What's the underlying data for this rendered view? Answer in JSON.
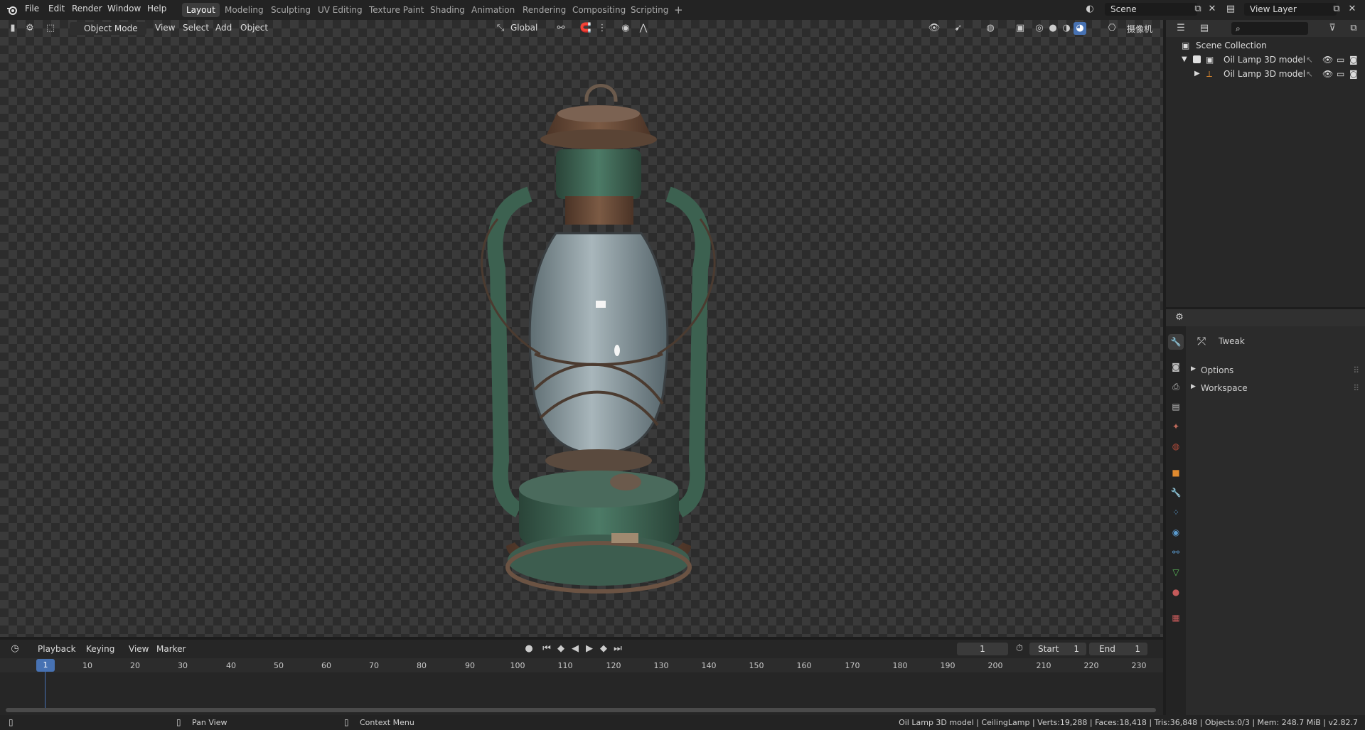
{
  "topbar": {
    "menus": [
      "File",
      "Edit",
      "Render",
      "Window",
      "Help"
    ],
    "workspaces": [
      "Layout",
      "Modeling",
      "Sculpting",
      "UV Editing",
      "Texture Paint",
      "Shading",
      "Animation",
      "Rendering",
      "Compositing",
      "Scripting"
    ],
    "active_workspace": "Layout",
    "add_tab": "+",
    "scene_name": "Scene",
    "view_layer": "View Layer"
  },
  "viewport_header": {
    "mode": "Object Mode",
    "menus": [
      "View",
      "Select",
      "Add",
      "Object"
    ],
    "orientation": "Global",
    "camera_label": "摄像机"
  },
  "outliner": {
    "search_placeholder": "",
    "root": "Scene Collection",
    "rows": [
      {
        "label": "Oil Lamp 3D model",
        "type": "collection"
      },
      {
        "label": "Oil Lamp 3D model",
        "type": "object"
      }
    ]
  },
  "properties": {
    "tool_name": "Tweak",
    "panels": [
      "Options",
      "Workspace"
    ],
    "tab_colors": [
      "#9a9a9a",
      "#bdbdbd",
      "#bdbdbd",
      "#bdbdbd",
      "#c06a5b",
      "#b24b3a",
      "#e08a2f",
      "#5a9bd0",
      "#5a9bd0",
      "#5a9bd0",
      "#5a9bd0",
      "#5bbf5b",
      "#c55a5a",
      "#c55a5a"
    ]
  },
  "timeline": {
    "menus": [
      "Playback",
      "Keying",
      "View",
      "Marker"
    ],
    "current_frame": "1",
    "start_label": "Start",
    "start_value": "1",
    "end_label": "End",
    "end_value": "1",
    "ruler_ticks": [
      "1",
      "10",
      "20",
      "30",
      "40",
      "50",
      "60",
      "70",
      "80",
      "90",
      "100",
      "110",
      "120",
      "130",
      "140",
      "150",
      "160",
      "170",
      "180",
      "190",
      "200",
      "210",
      "220",
      "230"
    ]
  },
  "statusbar": {
    "pan_view": "Pan View",
    "context_menu": "Context Menu",
    "stats": "Oil Lamp 3D model | CeilingLamp | Verts:19,288 | Faces:18,418 | Tris:36,848 | Objects:0/3 | Mem: 248.7 MiB | v2.82.7"
  },
  "colors": {
    "accent": "#4772b3",
    "lamp_green": "#3f6a58",
    "lamp_rust": "#6a4a36",
    "glass": "#8fa1a8"
  }
}
